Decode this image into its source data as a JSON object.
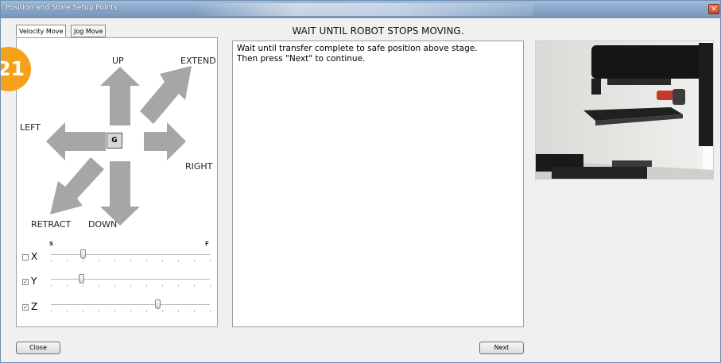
{
  "window": {
    "title": "Position and Store Setup Points",
    "close_glyph": "✕"
  },
  "tabs": [
    {
      "label": "Velocity Move",
      "active": true
    },
    {
      "label": "Jog Move",
      "active": false
    }
  ],
  "step_badge": "21",
  "joystick": {
    "up_label": "UP",
    "extend_label": "EXTEND",
    "left_label": "LEFT",
    "right_label": "RIGHT",
    "retract_label": "RETRACT",
    "down_label": "DOWN",
    "center_label": "G",
    "arrow_color": "#a6a6a6"
  },
  "speed": {
    "slow_label": "S",
    "fast_label": "F"
  },
  "axes": [
    {
      "label": "X",
      "checked": false,
      "speed_fraction": 0.2
    },
    {
      "label": "Y",
      "checked": true,
      "speed_fraction": 0.19
    },
    {
      "label": "Z",
      "checked": true,
      "speed_fraction": 0.67
    }
  ],
  "main": {
    "heading": "WAIT UNTIL ROBOT STOPS MOVING.",
    "message_line1": "Wait until transfer complete to safe position above stage.",
    "message_line2": "Then press \"Next\" to continue."
  },
  "buttons": {
    "close_label": "Close",
    "next_label": "Next"
  },
  "colors": {
    "badge": "#f5a21a",
    "title_bar": "#8aa7c8"
  }
}
